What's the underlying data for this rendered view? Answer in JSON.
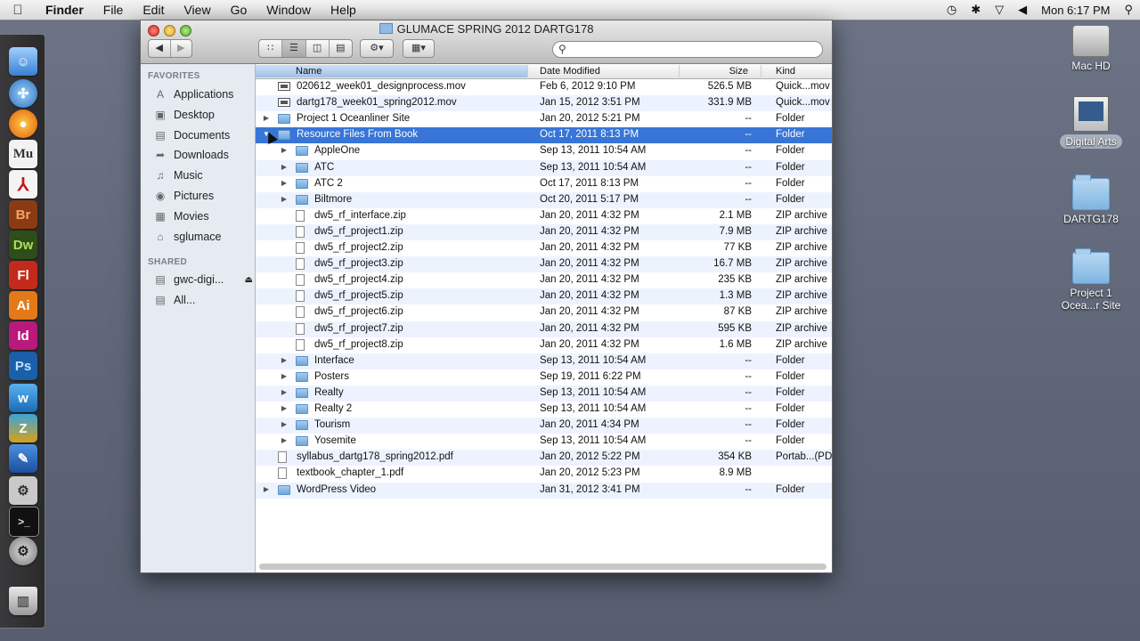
{
  "menubar": {
    "apple_icon": "",
    "items": [
      "Finder",
      "File",
      "Edit",
      "View",
      "Go",
      "Window",
      "Help"
    ],
    "clock": "Mon 6:17 PM"
  },
  "window": {
    "title": "GLUMACE SPRING 2012 DARTG178"
  },
  "sidebar": {
    "favorites_header": "FAVORITES",
    "favorites": [
      "Applications",
      "Desktop",
      "Documents",
      "Downloads",
      "Music",
      "Pictures",
      "Movies",
      "sglumace"
    ],
    "shared_header": "SHARED",
    "shared": [
      "gwc-digi...",
      "All..."
    ]
  },
  "columns": {
    "name": "Name",
    "date": "Date Modified",
    "size": "Size",
    "kind": "Kind"
  },
  "rows": [
    {
      "name": "020612_week01_designprocess.mov",
      "date": "Feb 6, 2012 9:10 PM",
      "size": "526.5 MB",
      "kind": "Quick...mov"
    },
    {
      "name": "dartg178_week01_spring2012.mov",
      "date": "Jan 15, 2012 3:51 PM",
      "size": "331.9 MB",
      "kind": "Quick...mov"
    },
    {
      "name": "Project 1 Oceanliner Site",
      "date": "Jan 20, 2012 5:21 PM",
      "size": "--",
      "kind": "Folder"
    },
    {
      "name": "Resource Files From Book",
      "date": "Oct 17, 2011 8:13 PM",
      "size": "--",
      "kind": "Folder"
    },
    {
      "name": "AppleOne",
      "date": "Sep 13, 2011 10:54 AM",
      "size": "--",
      "kind": "Folder"
    },
    {
      "name": "ATC",
      "date": "Sep 13, 2011 10:54 AM",
      "size": "--",
      "kind": "Folder"
    },
    {
      "name": "ATC 2",
      "date": "Oct 17, 2011 8:13 PM",
      "size": "--",
      "kind": "Folder"
    },
    {
      "name": "Biltmore",
      "date": "Oct 20, 2011 5:17 PM",
      "size": "--",
      "kind": "Folder"
    },
    {
      "name": "dw5_rf_interface.zip",
      "date": "Jan 20, 2011 4:32 PM",
      "size": "2.1 MB",
      "kind": "ZIP archive"
    },
    {
      "name": "dw5_rf_project1.zip",
      "date": "Jan 20, 2011 4:32 PM",
      "size": "7.9 MB",
      "kind": "ZIP archive"
    },
    {
      "name": "dw5_rf_project2.zip",
      "date": "Jan 20, 2011 4:32 PM",
      "size": "77 KB",
      "kind": "ZIP archive"
    },
    {
      "name": "dw5_rf_project3.zip",
      "date": "Jan 20, 2011 4:32 PM",
      "size": "16.7 MB",
      "kind": "ZIP archive"
    },
    {
      "name": "dw5_rf_project4.zip",
      "date": "Jan 20, 2011 4:32 PM",
      "size": "235 KB",
      "kind": "ZIP archive"
    },
    {
      "name": "dw5_rf_project5.zip",
      "date": "Jan 20, 2011 4:32 PM",
      "size": "1.3 MB",
      "kind": "ZIP archive"
    },
    {
      "name": "dw5_rf_project6.zip",
      "date": "Jan 20, 2011 4:32 PM",
      "size": "87 KB",
      "kind": "ZIP archive"
    },
    {
      "name": "dw5_rf_project7.zip",
      "date": "Jan 20, 2011 4:32 PM",
      "size": "595 KB",
      "kind": "ZIP archive"
    },
    {
      "name": "dw5_rf_project8.zip",
      "date": "Jan 20, 2011 4:32 PM",
      "size": "1.6 MB",
      "kind": "ZIP archive"
    },
    {
      "name": "Interface",
      "date": "Sep 13, 2011 10:54 AM",
      "size": "--",
      "kind": "Folder"
    },
    {
      "name": "Posters",
      "date": "Sep 19, 2011 6:22 PM",
      "size": "--",
      "kind": "Folder"
    },
    {
      "name": "Realty",
      "date": "Sep 13, 2011 10:54 AM",
      "size": "--",
      "kind": "Folder"
    },
    {
      "name": "Realty 2",
      "date": "Sep 13, 2011 10:54 AM",
      "size": "--",
      "kind": "Folder"
    },
    {
      "name": "Tourism",
      "date": "Jan 20, 2011 4:34 PM",
      "size": "--",
      "kind": "Folder"
    },
    {
      "name": "Yosemite",
      "date": "Sep 13, 2011 10:54 AM",
      "size": "--",
      "kind": "Folder"
    },
    {
      "name": "syllabus_dartg178_spring2012.pdf",
      "date": "Jan 20, 2012 5:22 PM",
      "size": "354 KB",
      "kind": "Portab...(PDF)"
    },
    {
      "name": "textbook_chapter_1.pdf",
      "date": "Jan 20, 2012 5:23 PM",
      "size": "8.9 MB",
      "kind": ""
    },
    {
      "name": "WordPress Video",
      "date": "Jan 31, 2012 3:41 PM",
      "size": "--",
      "kind": "Folder"
    }
  ],
  "desktop": {
    "items": [
      "Mac HD",
      "Digital Arts",
      "DARTG178",
      "Project 1 Ocea...r Site"
    ]
  },
  "dock": {
    "labels": [
      "Mu",
      "Br",
      "Dw",
      "Fl",
      "Ai",
      "Id",
      "Ps"
    ]
  }
}
